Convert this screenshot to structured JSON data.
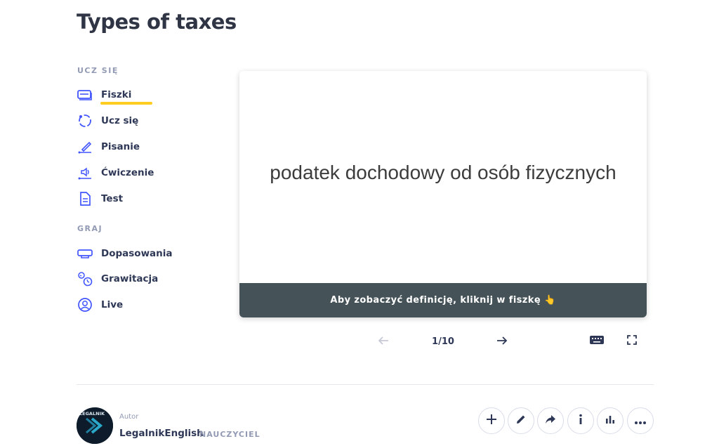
{
  "page": {
    "title": "Types of taxes"
  },
  "sidebar": {
    "learn_label": "UCZ SIĘ",
    "learn_items": [
      {
        "label": "Fiszki",
        "icon": "flashcards-icon"
      },
      {
        "label": "Ucz się",
        "icon": "learn-cycle-icon"
      },
      {
        "label": "Pisanie",
        "icon": "pencil-write-icon"
      },
      {
        "label": "Ćwiczenie",
        "icon": "speaker-icon"
      },
      {
        "label": "Test",
        "icon": "document-icon"
      }
    ],
    "play_label": "GRAJ",
    "play_items": [
      {
        "label": "Dopasowania",
        "icon": "match-cards-icon"
      },
      {
        "label": "Grawitacja",
        "icon": "gravity-icon"
      },
      {
        "label": "Live",
        "icon": "person-circle-icon"
      }
    ],
    "active_item": "Fiszki",
    "accent_color": "#ffcd1f"
  },
  "flashcard": {
    "term": "podatek dochodowy od osób fizycznych",
    "hint": "Aby zobaczyć definicję, kliknij w fiszkę 👆",
    "footer_color": "#455358"
  },
  "controls": {
    "counter": "1/10",
    "prev_icon": "arrow-left-icon",
    "next_icon": "arrow-right-icon",
    "keyboard_icon": "keyboard-icon",
    "fullscreen_icon": "fullscreen-icon"
  },
  "author": {
    "label": "Autor",
    "name": "LegalnikEnglish",
    "role": "NAUCZYCIEL",
    "avatar_text": "LEGALNIK"
  },
  "actions": [
    {
      "name": "add-button",
      "icon": "plus-icon"
    },
    {
      "name": "edit-button",
      "icon": "pencil-icon"
    },
    {
      "name": "share-button",
      "icon": "share-arrow-icon"
    },
    {
      "name": "info-button",
      "icon": "info-icon"
    },
    {
      "name": "stats-button",
      "icon": "bar-chart-icon"
    },
    {
      "name": "more-button",
      "icon": "more-dots-icon"
    }
  ]
}
